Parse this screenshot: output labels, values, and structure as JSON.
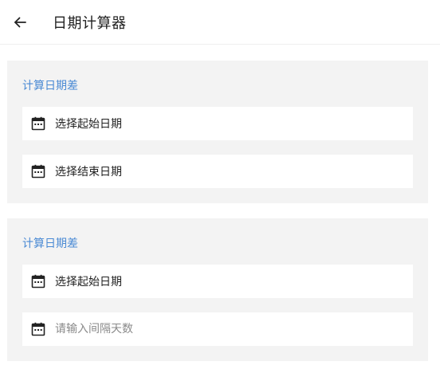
{
  "header": {
    "back_icon": "arrow-left-icon",
    "title": "日期计算器"
  },
  "card_diff": {
    "title": "计算日期差",
    "start_label": "选择起始日期",
    "end_label": "选择结束日期",
    "icon": "calendar-icon"
  },
  "card_offset": {
    "title": "计算日期差",
    "start_label": "选择起始日期",
    "days_placeholder": "请输入间隔天数",
    "days_value": "",
    "icon": "calendar-icon"
  },
  "colors": {
    "accent": "#4a8ad4",
    "card_bg": "#f3f3f3",
    "field_bg": "#ffffff"
  }
}
